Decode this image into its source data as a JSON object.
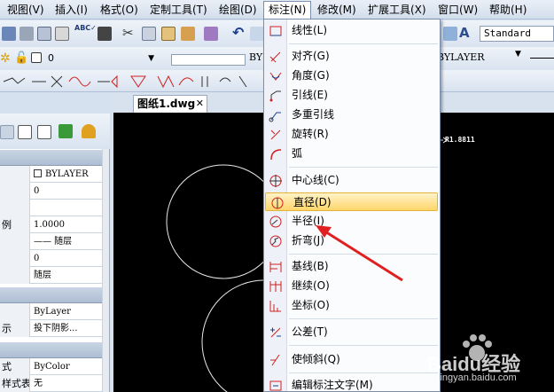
{
  "menubar": {
    "items": [
      "视图(V)",
      "插入(I)",
      "格式(O)",
      "定制工具(T)",
      "绘图(D)",
      "标注(N)",
      "修改(M)",
      "扩展工具(X)",
      "窗口(W)",
      "帮助(H)"
    ],
    "open_item": "标注(N)"
  },
  "toolbar": {
    "text_style": "Standard",
    "layer_name": "0",
    "linetype": "BY",
    "lineweight": "BYLAYER"
  },
  "document": {
    "tab_title": "图纸1.dwg",
    "close_glyph": "✕",
    "dimension_text": "R1.8811"
  },
  "properties": {
    "rows": [
      {
        "label": "",
        "value": "BYLAYER",
        "checkbox": true
      },
      {
        "label": "",
        "value": "0"
      },
      {
        "label": "",
        "value": ""
      },
      {
        "label": "例",
        "value": "1.0000"
      },
      {
        "label": "",
        "value": "—— 随层"
      },
      {
        "label": "",
        "value": "0"
      },
      {
        "label": "",
        "value": "随层"
      }
    ],
    "rows2": [
      {
        "label": "",
        "value": "ByLayer"
      },
      {
        "label": "示",
        "value": "投下阴影..."
      }
    ],
    "rows3": [
      {
        "label": "式",
        "value": "ByColor"
      },
      {
        "label": "样式表",
        "value": "无"
      }
    ]
  },
  "dropdown": {
    "items": [
      {
        "label": "线性(L)",
        "icon": "linear-dim-icon"
      },
      {
        "label": "对齐(G)",
        "icon": "aligned-dim-icon"
      },
      {
        "label": "角度(G)",
        "icon": "angular-dim-icon"
      },
      {
        "label": "引线(E)",
        "icon": "leader-icon"
      },
      {
        "label": "多重引线",
        "icon": "multileader-icon"
      },
      {
        "label": "旋转(R)",
        "icon": "rotated-dim-icon"
      },
      {
        "label": "弧",
        "icon": "arc-dim-icon"
      },
      {
        "label": "中心线(C)",
        "icon": "centerline-icon"
      },
      {
        "label": "直径(D)",
        "icon": "diameter-dim-icon",
        "highlighted": true
      },
      {
        "label": "半径(I)",
        "icon": "radius-dim-icon"
      },
      {
        "label": "折弯(J)",
        "icon": "jogged-dim-icon"
      },
      {
        "label": "基线(B)",
        "icon": "baseline-dim-icon"
      },
      {
        "label": "继续(O)",
        "icon": "continue-dim-icon"
      },
      {
        "label": "坐标(O)",
        "icon": "ordinate-dim-icon"
      },
      {
        "label": "公差(T)",
        "icon": "tolerance-icon"
      },
      {
        "label": "使倾斜(Q)",
        "icon": "oblique-icon"
      },
      {
        "label": "编辑标注文字(M)",
        "icon": "edit-dim-text-icon"
      }
    ]
  },
  "watermark": {
    "brand": "Baidu经验",
    "url": "jingyan.baidu.com"
  },
  "colors": {
    "accent": "#ffd66a",
    "canvas": "#000000",
    "arrow": "#e02020"
  }
}
